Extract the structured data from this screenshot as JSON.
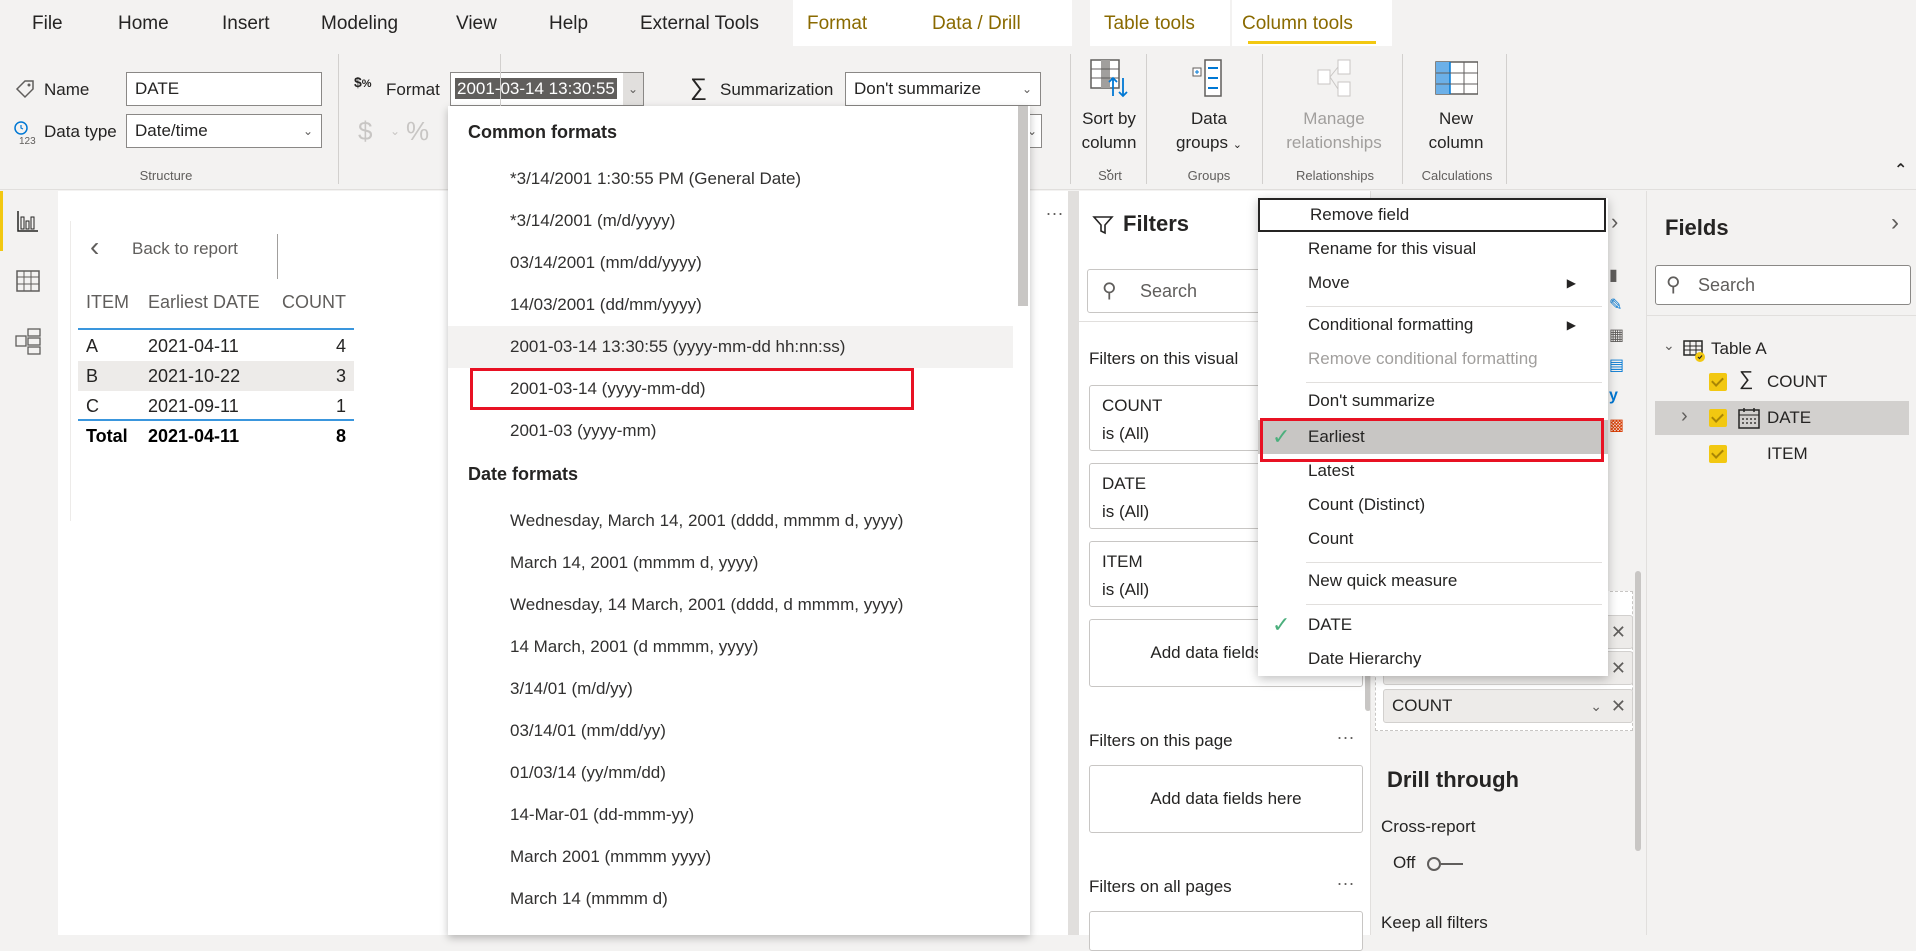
{
  "tabs": [
    {
      "label": "File",
      "contextual": false
    },
    {
      "label": "Home",
      "contextual": false
    },
    {
      "label": "Insert",
      "contextual": false
    },
    {
      "label": "Modeling",
      "contextual": false
    },
    {
      "label": "View",
      "contextual": false
    },
    {
      "label": "Help",
      "contextual": false
    },
    {
      "label": "External Tools",
      "contextual": false
    },
    {
      "label": "Format",
      "contextual": true
    },
    {
      "label": "Data / Drill",
      "contextual": true
    },
    {
      "label": "Table tools",
      "contextual": true
    },
    {
      "label": "Column tools",
      "contextual": true,
      "active": true
    }
  ],
  "ribbon": {
    "structure": {
      "name_label": "Name",
      "name_value": "DATE",
      "datatype_label": "Data type",
      "datatype_value": "Date/time",
      "group_label": "Structure"
    },
    "formatting": {
      "format_label": "Format",
      "format_value": "2001-03-14 13:30:55",
      "currency_symbol": "$",
      "percent_symbol": "%"
    },
    "properties": {
      "summarization_label": "Summarization",
      "summarization_value": "Don't summarize"
    },
    "sort": {
      "button_line1": "Sort by",
      "button_line2": "column",
      "group_label": "Sort"
    },
    "groups": {
      "button_line1": "Data",
      "button_line2": "groups",
      "group_label": "Groups"
    },
    "relationships": {
      "button_line1": "Manage",
      "button_line2": "relationships",
      "group_label": "Relationships",
      "disabled": true
    },
    "calculations": {
      "button_line1": "New",
      "button_line2": "column",
      "group_label": "Calculations"
    },
    "collapse_icon": "chevron-up-icon"
  },
  "leftnav": {
    "items": [
      {
        "icon": "report-view-icon",
        "active": true
      },
      {
        "icon": "data-view-icon",
        "active": false
      },
      {
        "icon": "model-view-icon",
        "active": false
      }
    ]
  },
  "canvas": {
    "back_label": "Back to report",
    "more_options": "...",
    "table": {
      "headers": [
        "ITEM",
        "Earliest DATE",
        "COUNT"
      ],
      "rows": [
        [
          "A",
          "2021-04-11",
          "4"
        ],
        [
          "B",
          "2021-10-22",
          "3"
        ],
        [
          "C",
          "2021-09-11",
          "1"
        ]
      ],
      "total": [
        "Total",
        "2021-04-11",
        "8"
      ]
    }
  },
  "format_dropdown": {
    "sections": [
      {
        "header": "Common formats",
        "items": [
          "*3/14/2001 1:30:55 PM (General Date)",
          "*3/14/2001 (m/d/yyyy)",
          "03/14/2001 (mm/dd/yyyy)",
          "14/03/2001 (dd/mm/yyyy)",
          "2001-03-14 13:30:55 (yyyy-mm-dd hh:nn:ss)",
          "2001-03-14 (yyyy-mm-dd)",
          "2001-03 (yyyy-mm)"
        ],
        "hovered_index": 4,
        "highlighted_index": 5
      },
      {
        "header": "Date formats",
        "items": [
          "Wednesday, March 14, 2001 (dddd, mmmm d, yyyy)",
          "March 14, 2001 (mmmm d, yyyy)",
          "Wednesday, 14 March, 2001 (dddd, d mmmm, yyyy)",
          "14 March, 2001 (d mmmm, yyyy)",
          "3/14/01 (m/d/yy)",
          "03/14/01 (mm/dd/yy)",
          "01/03/14 (yy/mm/dd)",
          "14-Mar-01 (dd-mmm-yy)",
          "March 2001 (mmmm yyyy)",
          "March 14 (mmmm d)"
        ]
      }
    ]
  },
  "filters": {
    "title": "Filters",
    "search_placeholder": "Search",
    "on_visual_label": "Filters on this visual",
    "visual_cards": [
      {
        "field": "COUNT",
        "state": "is (All)"
      },
      {
        "field": "DATE",
        "state": "is (All)"
      },
      {
        "field": "ITEM",
        "state": "is (All)"
      }
    ],
    "add_fields_label": "Add data fields here",
    "on_page_label": "Filters on this page",
    "on_all_pages_label": "Filters on all pages",
    "more_options": "..."
  },
  "viz": {
    "wells": [
      "",
      "",
      "COUNT"
    ],
    "drill_through_title": "Drill through",
    "cross_report_label": "Cross-report",
    "cross_report_state": "Off",
    "keep_filters_label": "Keep all filters"
  },
  "fields": {
    "title": "Fields",
    "search_placeholder": "Search",
    "table_name": "Table A",
    "items": [
      {
        "name": "COUNT",
        "icon": "sigma-icon",
        "checked": true
      },
      {
        "name": "DATE",
        "icon": "calendar-icon",
        "checked": true,
        "selected": true,
        "expandable": true
      },
      {
        "name": "ITEM",
        "icon": "",
        "checked": true
      }
    ]
  },
  "context_menu": {
    "items": [
      {
        "label": "Remove field",
        "focused": true
      },
      {
        "label": "Rename for this visual"
      },
      {
        "label": "Move",
        "submenu": true
      },
      {
        "separator": true
      },
      {
        "label": "Conditional formatting",
        "submenu": true
      },
      {
        "label": "Remove conditional formatting",
        "disabled": true
      },
      {
        "separator": true
      },
      {
        "label": "Don't summarize"
      },
      {
        "label": "Earliest",
        "checked": true,
        "selected": true
      },
      {
        "label": "Latest"
      },
      {
        "label": "Count (Distinct)"
      },
      {
        "label": "Count"
      },
      {
        "separator": true
      },
      {
        "label": "New quick measure"
      },
      {
        "separator": true
      },
      {
        "label": "DATE",
        "checked": true
      },
      {
        "label": "Date Hierarchy"
      }
    ]
  },
  "colors": {
    "accent_yellow": "#f2c811",
    "highlight_red": "#e81123",
    "check_green": "#4caf7d",
    "table_rule_blue": "#3a96dd"
  }
}
